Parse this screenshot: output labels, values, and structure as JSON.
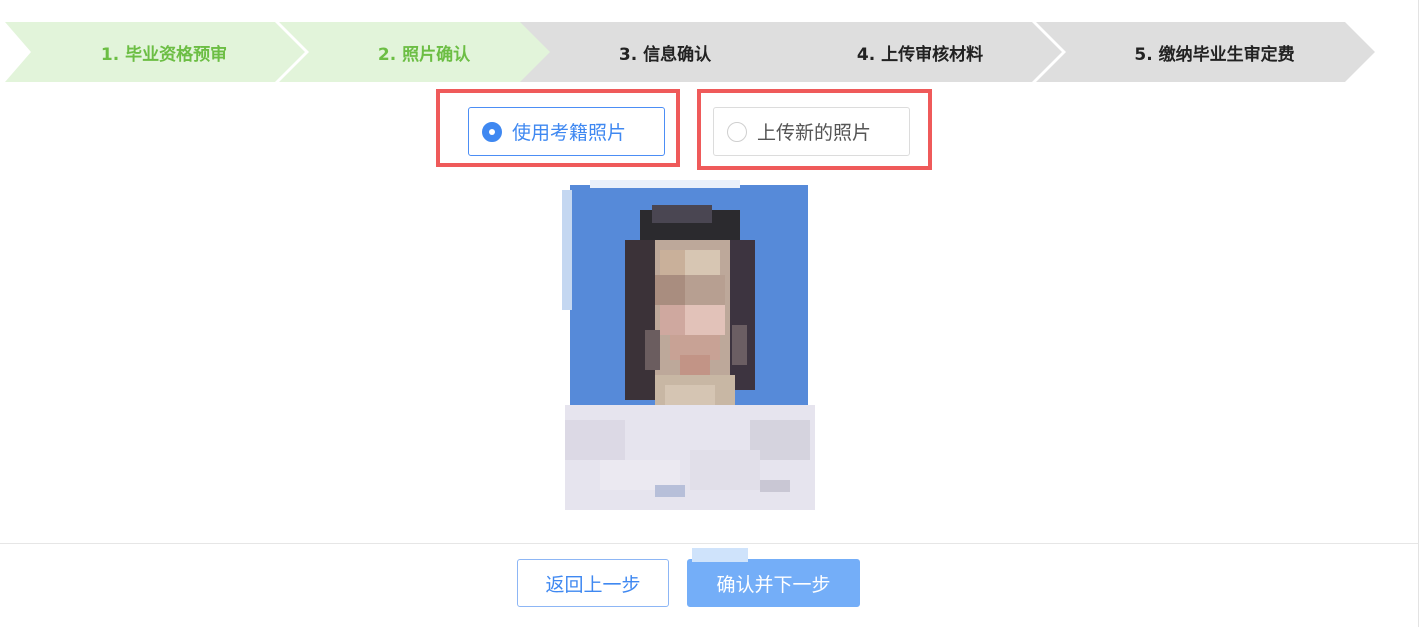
{
  "stepper": {
    "steps": [
      {
        "label": "1. 毕业资格预审",
        "state": "done"
      },
      {
        "label": "2. 照片确认",
        "state": "done"
      },
      {
        "label": "3. 信息确认",
        "state": "todo"
      },
      {
        "label": "4. 上传审核材料",
        "state": "todo"
      },
      {
        "label": "5. 缴纳毕业生审定费",
        "state": "todo"
      }
    ]
  },
  "photo_choice": {
    "option_use_exam_photo": "使用考籍照片",
    "option_upload_new": "上传新的照片",
    "selected": "使用考籍照片"
  },
  "photo": {
    "alt": "考籍照片",
    "background_color": "#568ad9"
  },
  "footer": {
    "back_label": "返回上一步",
    "next_label": "确认并下一步"
  },
  "colors": {
    "accent": "#3f88f1",
    "step_done_bg": "#e2f4da",
    "step_done_text": "#6cbe44",
    "step_todo_bg": "#dedede",
    "highlight": "#ef5a5a"
  }
}
